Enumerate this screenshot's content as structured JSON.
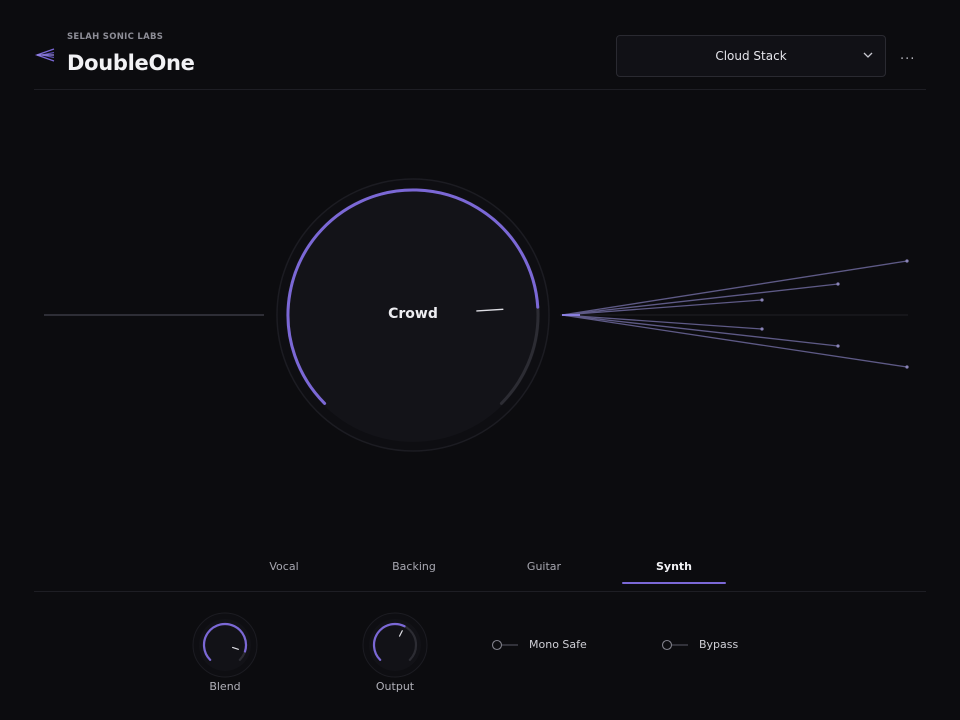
{
  "header": {
    "brand": "SELAH SONIC LABS",
    "title": "DoubleOne",
    "preset": {
      "value": "Cloud Stack"
    },
    "more_label": "..."
  },
  "main_knob": {
    "label": "Crowd",
    "value_fraction": 0.82
  },
  "tabs": [
    {
      "label": "Vocal",
      "active": false
    },
    {
      "label": "Backing",
      "active": false
    },
    {
      "label": "Guitar",
      "active": false
    },
    {
      "label": "Synth",
      "active": true
    }
  ],
  "controls": {
    "blend": {
      "label": "Blend",
      "value_fraction": 0.9
    },
    "output": {
      "label": "Output",
      "value_fraction": 0.6
    },
    "mono_safe": {
      "label": "Mono Safe",
      "on": false
    },
    "bypass": {
      "label": "Bypass",
      "on": false
    }
  },
  "colors": {
    "accent": "#7b68d6",
    "background": "#0c0c0f",
    "voice_lines": "#5e5a86"
  }
}
